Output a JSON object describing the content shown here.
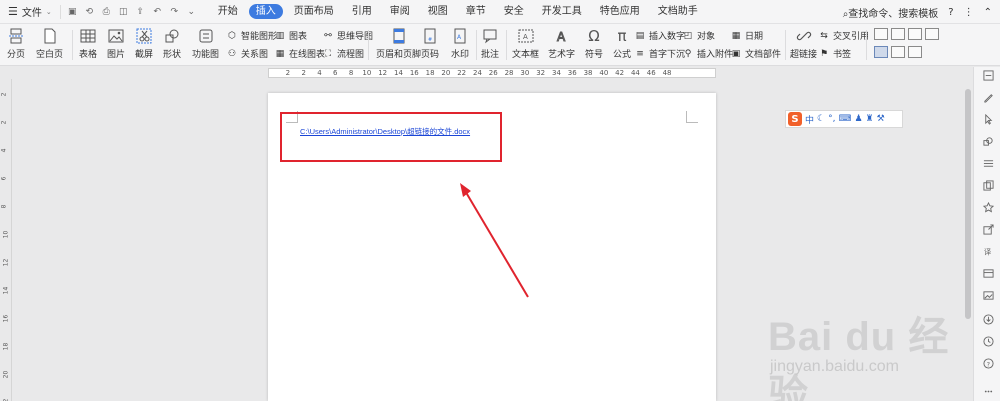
{
  "menubar": {
    "file_label": "文件",
    "tabs": [
      "开始",
      "插入",
      "页面布局",
      "引用",
      "审阅",
      "视图",
      "章节",
      "安全",
      "开发工具",
      "特色应用",
      "文档助手"
    ],
    "active_tab": "插入",
    "search_label": "查找命令、搜索模板",
    "help_label": "?"
  },
  "ribbon": {
    "page_break": "分页",
    "blank_page": "空白页",
    "table": "表格",
    "picture": "图片",
    "screenshot": "截屏",
    "shape": "形状",
    "function_chart": "功能图",
    "smart_art": "智能图形",
    "chart": "图表",
    "mind_map": "思维导图",
    "relation_chart": "关系图",
    "online_chart": "在线图表",
    "flowchart": "流程图",
    "header_footer": "页眉和页脚",
    "page_number": "页码",
    "watermark": "水印",
    "comment": "批注",
    "text_box": "文本框",
    "art_text": "艺术字",
    "symbol": "符号",
    "formula": "公式",
    "insert_number": "插入数字",
    "object": "对象",
    "date": "日期",
    "drop_cap": "首字下沉",
    "attachment": "插入附件",
    "doc_parts": "文档部件",
    "hyperlink": "超链接",
    "cross_ref": "交叉引用",
    "bookmark": "书签"
  },
  "ruler": {
    "h_numbers": [
      "2",
      "2",
      "4",
      "6",
      "8",
      "10",
      "12",
      "14",
      "16",
      "18",
      "20",
      "22",
      "24",
      "26",
      "28",
      "30",
      "32",
      "34",
      "36",
      "38",
      "40",
      "42",
      "44",
      "46",
      "48"
    ],
    "v_numbers": [
      "2",
      "2",
      "4",
      "6",
      "8",
      "10",
      "12",
      "14",
      "16",
      "18",
      "20",
      "22"
    ]
  },
  "document": {
    "hyperlink_text": "C:\\Users\\Administrator\\Desktop\\超链接的文件.docx"
  },
  "ime": {
    "mode": "中",
    "logo": "S"
  },
  "colors": {
    "accent": "#3d7be0",
    "highlight_box": "#e0242e",
    "link": "#1a45d6"
  },
  "watermark": {
    "logo": "Bai du 经验",
    "url": "jingyan.baidu.com"
  }
}
